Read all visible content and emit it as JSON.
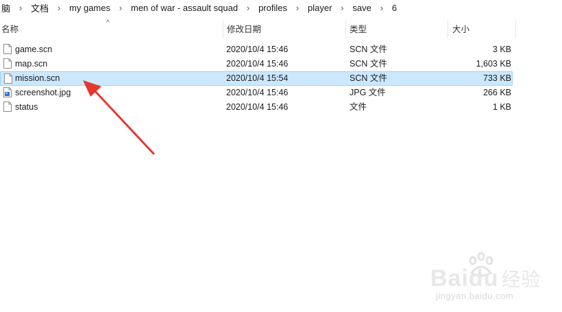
{
  "breadcrumb": [
    "脑",
    "文档",
    "my games",
    "men of war - assault squad",
    "profiles",
    "player",
    "save",
    "6"
  ],
  "columns": {
    "name": "名称",
    "modified": "修改日期",
    "type": "类型",
    "size": "大小"
  },
  "files": [
    {
      "name": "game.scn",
      "modified": "2020/10/4 15:46",
      "type": "SCN 文件",
      "size": "3 KB",
      "icon": "document-icon"
    },
    {
      "name": "map.scn",
      "modified": "2020/10/4 15:46",
      "type": "SCN 文件",
      "size": "1,603 KB",
      "icon": "document-icon"
    },
    {
      "name": "mission.scn",
      "modified": "2020/10/4 15:54",
      "type": "SCN 文件",
      "size": "733 KB",
      "icon": "document-icon",
      "selected": true
    },
    {
      "name": "screenshot.jpg",
      "modified": "2020/10/4 15:46",
      "type": "JPG 文件",
      "size": "266 KB",
      "icon": "image-file-icon"
    },
    {
      "name": "status",
      "modified": "2020/10/4 15:46",
      "type": "文件",
      "size": "1 KB",
      "icon": "document-icon"
    }
  ],
  "annotation": {
    "color": "#e8352f"
  },
  "watermark": {
    "brand": "Bai",
    "brand2": "du",
    "label": "经验",
    "url": "jingyan.baidu.com"
  }
}
